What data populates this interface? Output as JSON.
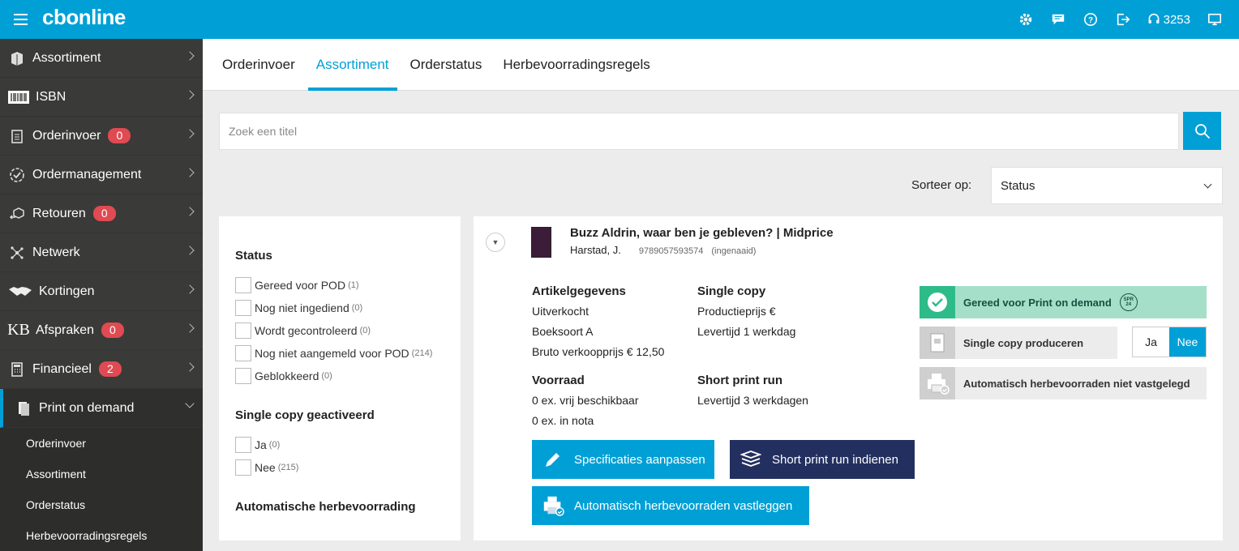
{
  "header": {
    "logo_light": "cb",
    "logo_bold": "online",
    "support_number": "3253",
    "icons": [
      "menu-icon",
      "settings-icon",
      "chat-icon",
      "help-icon",
      "logout-icon",
      "headset-icon",
      "monitor-icon"
    ]
  },
  "sidebar": {
    "items": [
      {
        "label": "Assortiment",
        "badge": null
      },
      {
        "label": "ISBN",
        "badge": null
      },
      {
        "label": "Orderinvoer",
        "badge": "0"
      },
      {
        "label": "Ordermanagement",
        "badge": null
      },
      {
        "label": "Retouren",
        "badge": "0"
      },
      {
        "label": "Netwerk",
        "badge": null
      },
      {
        "label": "Kortingen",
        "badge": null
      },
      {
        "label": "Afspraken",
        "badge": "0"
      },
      {
        "label": "Financieel",
        "badge": "2"
      },
      {
        "label": "Print on demand",
        "badge": null
      }
    ],
    "subitems": [
      "Orderinvoer",
      "Assortiment",
      "Orderstatus",
      "Herbevoorradingsregels"
    ]
  },
  "tabs": [
    "Orderinvoer",
    "Assortiment",
    "Orderstatus",
    "Herbevoorradingsregels"
  ],
  "active_tab": "Assortiment",
  "search": {
    "placeholder": "Zoek een titel",
    "value": ""
  },
  "sort": {
    "label": "Sorteer op:",
    "value": "Status"
  },
  "filters": {
    "status": {
      "title": "Status",
      "options": [
        {
          "label": "Gereed voor POD",
          "count": "(1)"
        },
        {
          "label": "Nog niet ingediend",
          "count": "(0)"
        },
        {
          "label": "Wordt gecontroleerd",
          "count": "(0)"
        },
        {
          "label": "Nog niet aangemeld voor POD",
          "count": "(214)"
        },
        {
          "label": "Geblokkeerd",
          "count": "(0)"
        }
      ]
    },
    "single_copy": {
      "title": "Single copy geactiveerd",
      "options": [
        {
          "label": "Ja",
          "count": "(0)"
        },
        {
          "label": "Nee",
          "count": "(215)"
        }
      ]
    },
    "auto_title": "Automatische herbevoorrading"
  },
  "book": {
    "title": "Buzz Aldrin, waar ben je gebleven? | Midprice",
    "author": "Harstad, J.",
    "isbn": "9789057593574",
    "binding": "(ingenaaid)",
    "artikel": {
      "heading": "Artikelgegevens",
      "lines": [
        "Uitverkocht",
        "Boeksoort A",
        "Bruto verkoopprijs € 12,50"
      ]
    },
    "single_copy": {
      "heading": "Single copy",
      "lines": [
        "Productieprijs €",
        "Levertijd 1 werkdag"
      ]
    },
    "voorraad": {
      "heading": "Voorraad",
      "lines": [
        "0 ex. vrij beschikbaar",
        "0 ex. in nota"
      ]
    },
    "short_run": {
      "heading": "Short print run",
      "lines": [
        "Levertijd 3 werkdagen"
      ]
    },
    "status_pod": "Gereed voor Print on demand",
    "spr_badge": "SPR 24",
    "single_copy_produce": "Single copy produceren",
    "toggle": {
      "yes": "Ja",
      "no": "Nee",
      "selected": "Nee"
    },
    "auto_status": "Automatisch herbevoorraden niet vastgelegd",
    "buttons": {
      "edit_specs": "Specificaties aanpassen",
      "short_run": "Short print run indienen",
      "auto_restock": "Automatisch herbevoorraden vastleggen"
    }
  },
  "colors": {
    "primary": "#00a0d6",
    "sidebar": "#3a3a38",
    "badge": "#e04a52",
    "navy": "#23305f",
    "success": "#2dbb8a"
  }
}
